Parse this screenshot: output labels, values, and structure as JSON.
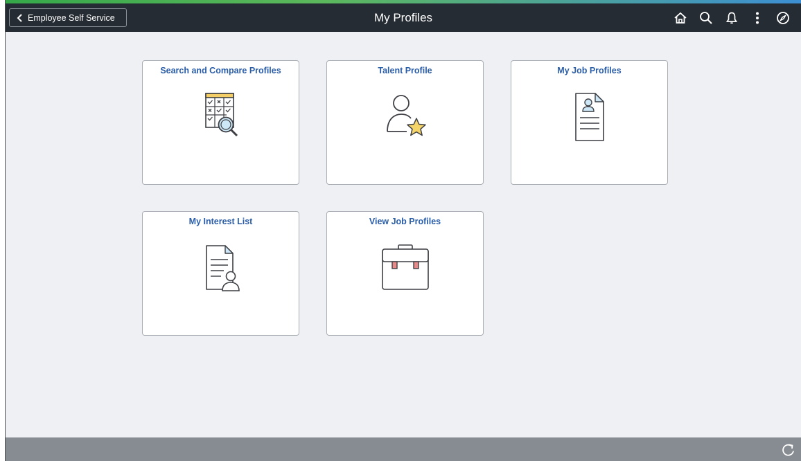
{
  "header": {
    "back_label": "Employee Self Service",
    "title": "My Profiles",
    "icons": [
      "home-icon",
      "search-icon",
      "notification-bell-icon",
      "actions-menu-icon",
      "navbar-compass-icon"
    ]
  },
  "tiles": [
    {
      "title": "Search and Compare Profiles",
      "icon": "compare-grid-magnifier-icon"
    },
    {
      "title": "Talent Profile",
      "icon": "person-star-icon"
    },
    {
      "title": "My Job Profiles",
      "icon": "profile-document-icon"
    },
    {
      "title": "My Interest List",
      "icon": "document-person-icon"
    },
    {
      "title": "View Job Profiles",
      "icon": "briefcase-icon"
    }
  ],
  "footer": {
    "icon": "refresh-icon"
  },
  "colors": {
    "header_bg": "#262c33",
    "page_bg": "#eff0f4",
    "tile_title": "#2a5da8",
    "footer_bg": "#878c92"
  }
}
